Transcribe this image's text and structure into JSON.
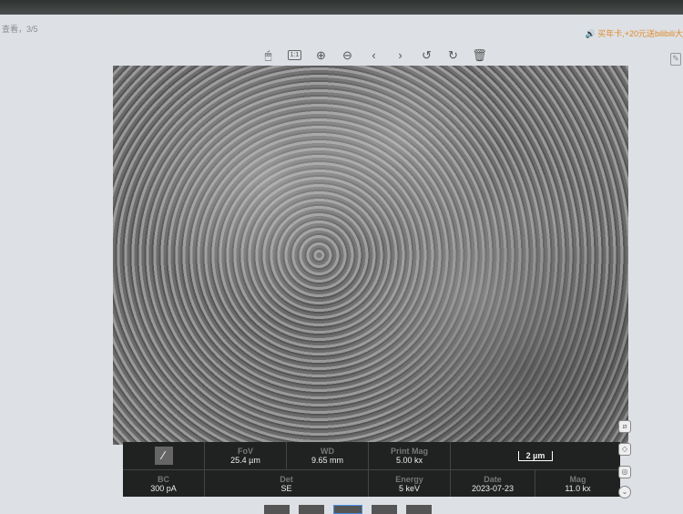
{
  "window": {
    "title": "查看，3/5",
    "promo": "买年卡,+20元送bilibili大"
  },
  "toolbar": [
    {
      "name": "mouse-icon",
      "glyph": "🖱"
    },
    {
      "name": "actual-size-icon",
      "glyph": "1:1"
    },
    {
      "name": "zoom-in-icon",
      "glyph": "⊕"
    },
    {
      "name": "zoom-out-icon",
      "glyph": "⊖"
    },
    {
      "name": "previous-icon",
      "glyph": "‹"
    },
    {
      "name": "next-icon",
      "glyph": "›"
    },
    {
      "name": "rotate-left-icon",
      "glyph": "↺"
    },
    {
      "name": "rotate-right-icon",
      "glyph": "↻"
    },
    {
      "name": "delete-icon",
      "glyph": "🗑"
    }
  ],
  "info": {
    "fov_label": "FoV",
    "fov": "25.4 µm",
    "wd_label": "WD",
    "wd": "9.65 mm",
    "printmag_label": "Print Mag",
    "printmag": "5.00 kx",
    "scale": "2 µm",
    "bc_label": "BC",
    "bc": "300 pA",
    "det_label": "Det",
    "det": "SE",
    "energy_label": "Energy",
    "energy": "5 keV",
    "date_label": "Date",
    "date": "2023-07-23",
    "mag_label": "Mag",
    "mag": "11.0 kx"
  }
}
